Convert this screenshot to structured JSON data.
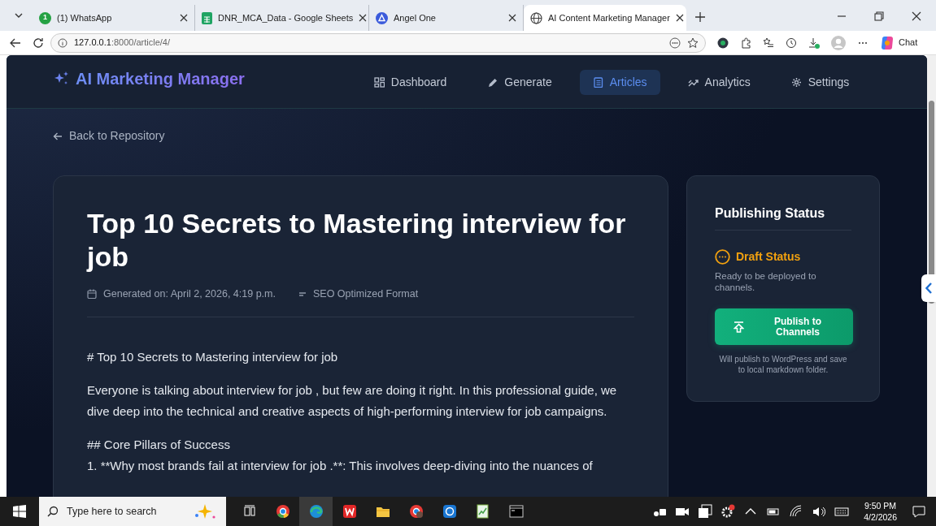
{
  "browser": {
    "tabs": [
      {
        "title": "(1) WhatsApp",
        "kind": "whatsapp",
        "badge": "1",
        "selected": false
      },
      {
        "title": "DNR_MCA_Data - Google Sheets",
        "kind": "sheets",
        "selected": false
      },
      {
        "title": "Angel One",
        "kind": "angel",
        "selected": false
      },
      {
        "title": "AI Content Marketing Manager",
        "kind": "globe",
        "selected": true
      }
    ],
    "url_host": "127.0.0.1",
    "url_path": ":8000/article/4/",
    "chat_label": "Chat"
  },
  "app": {
    "brand": "AI Marketing Manager",
    "nav": [
      {
        "label": "Dashboard",
        "kind": "grid",
        "selected": false
      },
      {
        "label": "Generate",
        "kind": "pen",
        "selected": false
      },
      {
        "label": "Articles",
        "kind": "doc",
        "selected": true
      },
      {
        "label": "Analytics",
        "kind": "chart",
        "selected": false
      },
      {
        "label": "Settings",
        "kind": "gear",
        "selected": false
      }
    ],
    "back_link": "Back to Repository",
    "article": {
      "title": "Top 10 Secrets to Mastering interview for job",
      "meta": [
        {
          "kind": "calendar",
          "text": "Generated on: April 2, 2026, 4:19 p.m."
        },
        {
          "kind": "format",
          "text": "SEO Optimized Format"
        }
      ],
      "blocks": [
        {
          "lines": [
            "# Top 10 Secrets to Mastering interview for job"
          ]
        },
        {
          "lines": [
            "Everyone is talking about interview for job , but few are doing it right. In this professional guide, we dive deep into the technical and creative aspects of high-performing interview for job campaigns."
          ]
        },
        {
          "lines": [
            "## Core Pillars of Success",
            "1. **Why most brands fail at interview for job .**: This involves deep-diving into the nuances of"
          ]
        }
      ]
    },
    "publishing": {
      "title": "Publishing Status",
      "status": "Draft Status",
      "description": "Ready to be deployed to channels.",
      "button": "Publish to Channels",
      "note": "Will publish to WordPress and save to local markdown folder."
    }
  },
  "taskbar": {
    "search_placeholder": "Type here to search",
    "time": "9:50 PM",
    "date": "4/2/2026"
  }
}
